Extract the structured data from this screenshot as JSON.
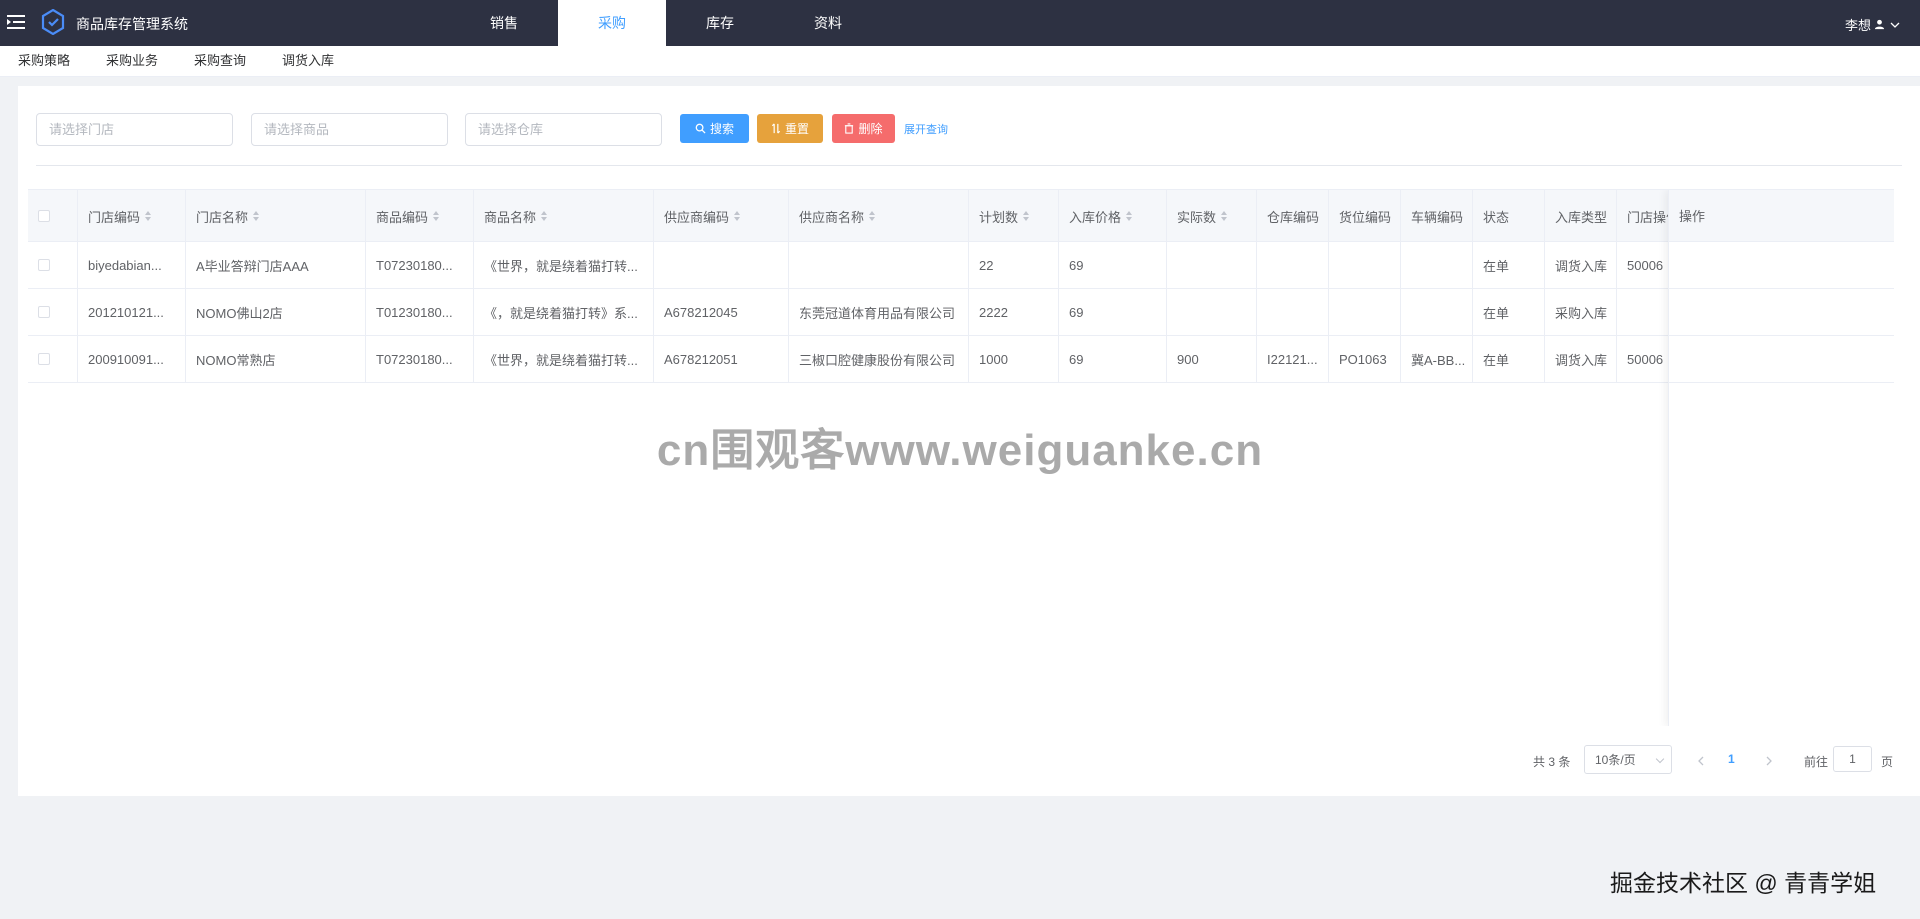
{
  "app": {
    "title": "商品库存管理系统",
    "user": "李想"
  },
  "nav": {
    "tabs": [
      {
        "label": "销售"
      },
      {
        "label": "采购"
      },
      {
        "label": "库存"
      },
      {
        "label": "资料"
      }
    ],
    "active": "采购"
  },
  "subnav": {
    "items": [
      "采购策略",
      "采购业务",
      "采购查询",
      "调货入库"
    ]
  },
  "filters": {
    "store_placeholder": "请选择门店",
    "product_placeholder": "请选择商品",
    "warehouse_placeholder": "请选择仓库",
    "search_label": "搜索",
    "reset_label": "重置",
    "delete_label": "删除",
    "expand_label": "展开查询"
  },
  "table": {
    "headers": [
      "门店编码",
      "门店名称",
      "商品编码",
      "商品名称",
      "供应商编码",
      "供应商名称",
      "计划数",
      "入库价格",
      "实际数",
      "仓库编码",
      "货位编码",
      "车辆编码",
      "状态",
      "入库类型",
      "门店操作",
      "操作"
    ],
    "rows": [
      [
        "biyedabian...",
        "A毕业答辩门店AAA",
        "T07230180...",
        "《世界，就是绕着猫打转...",
        "",
        "",
        "22",
        "69",
        "",
        "",
        "",
        "",
        "在单",
        "调货入库",
        "50006"
      ],
      [
        "201210121...",
        "NOMO佛山2店",
        "T01230180...",
        "《，就是绕着猫打转》系...",
        "A678212045",
        "东莞冠道体育用品有限公司",
        "2222",
        "69",
        "",
        "",
        "",
        "",
        "在单",
        "采购入库",
        ""
      ],
      [
        "200910091...",
        "NOMO常熟店",
        "T07230180...",
        "《世界，就是绕着猫打转...",
        "A678212051",
        "三椒口腔健康股份有限公司",
        "1000",
        "69",
        "900",
        "I22121...",
        "PO1063",
        "冀A-BB...",
        "在单",
        "调货入库",
        "50006"
      ]
    ]
  },
  "pagination": {
    "total_text": "共 3 条",
    "page_size": "10条/页",
    "current_page": "1",
    "goto_label": "前往",
    "goto_value": "1",
    "page_unit": "页"
  },
  "watermarks": {
    "center": "cn围观客www.weiguanke.cn",
    "corner": "掘金技术社区 @ 青青学姐"
  },
  "colors": {
    "topbar": "#2d3142",
    "primary": "#409eff",
    "warning": "#e6a23c",
    "danger": "#f56c6c"
  }
}
